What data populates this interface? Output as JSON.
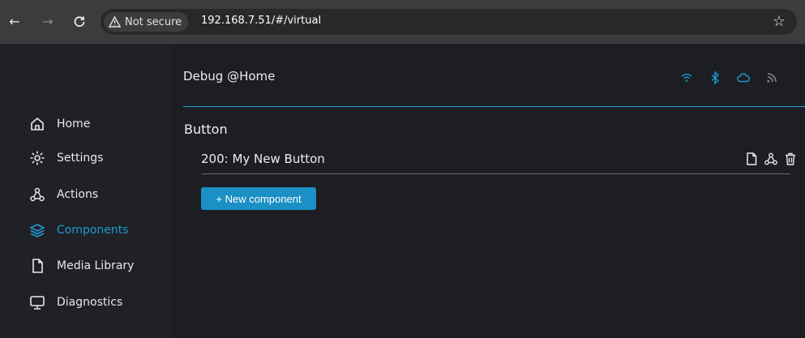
{
  "browser": {
    "security_label": "Not secure",
    "url": "192.168.7.51/#/virtual"
  },
  "sidebar": {
    "items": [
      {
        "label": "Home",
        "icon": "home-icon"
      },
      {
        "label": "Settings",
        "icon": "gear-icon"
      },
      {
        "label": "Actions",
        "icon": "actions-icon"
      },
      {
        "label": "Components",
        "icon": "layers-icon",
        "active": true
      },
      {
        "label": "Media Library",
        "icon": "file-icon"
      },
      {
        "label": "Diagnostics",
        "icon": "monitor-icon"
      }
    ]
  },
  "header": {
    "title": "Debug @Home",
    "status_icons": [
      "wifi-icon",
      "bluetooth-icon",
      "cloud-icon",
      "rss-icon"
    ]
  },
  "main": {
    "section_title": "Button",
    "components": [
      {
        "label": "200: My New Button"
      }
    ],
    "new_component_label": "+ New component"
  },
  "colors": {
    "accent": "#1e9bd0",
    "button": "#1b90c4",
    "background": "#1c1e23"
  }
}
